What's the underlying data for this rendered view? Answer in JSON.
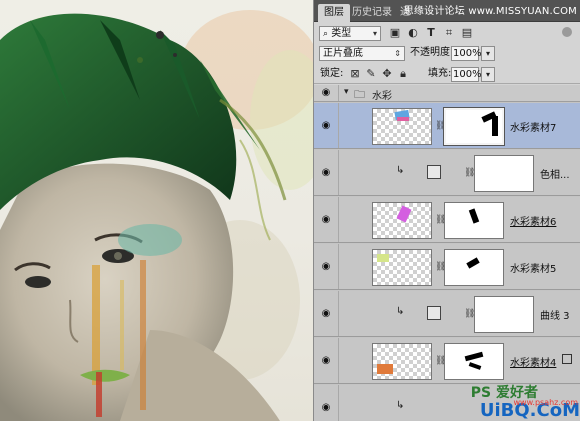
{
  "panel": {
    "tabs": [
      {
        "label": "图层",
        "active": true
      },
      {
        "label": "历史记录",
        "active": false
      },
      {
        "label": "通",
        "active": false
      }
    ],
    "watermark_top": "思缘设计论坛 www.MISSYUAN.COM",
    "filter": {
      "label": "类型",
      "icon": "search-icon"
    },
    "blend_mode": "正片叠底",
    "opacity_label": "不透明度:",
    "opacity_value": "100%",
    "lock_label": "锁定:",
    "fill_label": "填充:",
    "fill_value": "100%",
    "group_name": "水彩",
    "layers": [
      {
        "name": "水彩素材7",
        "selected": true,
        "type": "pixel"
      },
      {
        "name": "色相...",
        "selected": false,
        "type": "adjustment"
      },
      {
        "name": "水彩素材6",
        "selected": false,
        "type": "pixel"
      },
      {
        "name": "水彩素材5",
        "selected": false,
        "type": "pixel"
      },
      {
        "name": "曲线 3",
        "selected": false,
        "type": "adjustment"
      },
      {
        "name": "水彩素材4",
        "selected": false,
        "type": "pixel"
      }
    ]
  },
  "watermark_bottom": {
    "brand": "UiBQ.CoM",
    "site": "PS 爱好者",
    "url": "www.psahz.com"
  },
  "colors": {
    "panel_bg": "#d4d4d4",
    "tabbar": "#535353",
    "selection": "#a8b9d9",
    "foliage": "#1f5a2a"
  }
}
